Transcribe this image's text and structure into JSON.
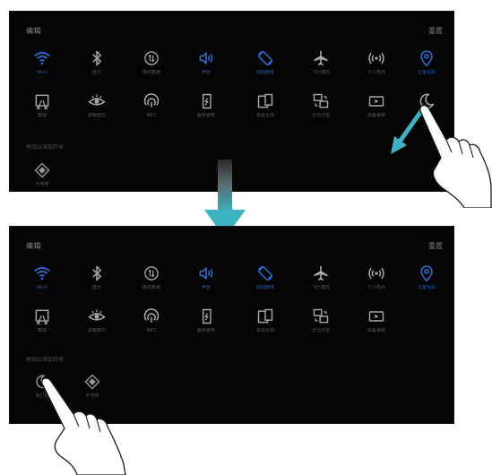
{
  "colors": {
    "panel_bg": "#050505",
    "active_blue": "#2f6fdc",
    "inactive_gray": "#8a8a8a",
    "arrow_teal": "#3bb3c3",
    "arrow_dark": "#2a2a2a"
  },
  "top_panel": {
    "title": "编辑",
    "action": "重置",
    "tiles_row1": [
      {
        "label": "Wi-Fi",
        "icon": "wifi-icon",
        "active": true
      },
      {
        "label": "蓝牙",
        "icon": "bluetooth-icon",
        "active": false
      },
      {
        "label": "移动数据",
        "icon": "mobile-data-icon",
        "active": false
      },
      {
        "label": "声音",
        "icon": "sound-icon",
        "active": true
      },
      {
        "label": "自动旋转",
        "icon": "rotate-icon",
        "active": true
      },
      {
        "label": "飞行模式",
        "icon": "airplane-icon",
        "active": false
      },
      {
        "label": "个人热点",
        "icon": "hotspot-icon",
        "active": false
      },
      {
        "label": "位置信息",
        "icon": "location-icon",
        "active": true
      }
    ],
    "tiles_row2": [
      {
        "label": "截屏",
        "icon": "screenshot-icon",
        "active": false
      },
      {
        "label": "护眼模式",
        "icon": "eye-comfort-icon",
        "active": false
      },
      {
        "label": "NFC",
        "icon": "nfc-icon",
        "active": false
      },
      {
        "label": "超级省电",
        "icon": "power-saving-icon",
        "active": false
      },
      {
        "label": "多屏互动",
        "icon": "multi-screen-icon",
        "active": false
      },
      {
        "label": "华为分享",
        "icon": "share-icon",
        "active": false
      },
      {
        "label": "屏幕录制",
        "icon": "screen-record-icon",
        "active": false
      },
      {
        "label": "免打扰",
        "icon": "moon-icon",
        "active": false
      }
    ],
    "section_label": "拖动以添加开关",
    "extra_tiles": [
      {
        "label": "手电筒",
        "icon": "diamond-icon"
      }
    ]
  },
  "bottom_panel": {
    "title": "编辑",
    "action": "重置",
    "tiles_row1": [
      {
        "label": "Wi-Fi",
        "icon": "wifi-icon",
        "active": true
      },
      {
        "label": "蓝牙",
        "icon": "bluetooth-icon",
        "active": false
      },
      {
        "label": "移动数据",
        "icon": "mobile-data-icon",
        "active": false
      },
      {
        "label": "声音",
        "icon": "sound-icon",
        "active": true
      },
      {
        "label": "自动旋转",
        "icon": "rotate-icon",
        "active": true
      },
      {
        "label": "飞行模式",
        "icon": "airplane-icon",
        "active": false
      },
      {
        "label": "个人热点",
        "icon": "hotspot-icon",
        "active": false
      },
      {
        "label": "位置信息",
        "icon": "location-icon",
        "active": true
      }
    ],
    "tiles_row2": [
      {
        "label": "截屏",
        "icon": "screenshot-icon",
        "active": false
      },
      {
        "label": "护眼模式",
        "icon": "eye-comfort-icon",
        "active": false
      },
      {
        "label": "NFC",
        "icon": "nfc-icon",
        "active": false
      },
      {
        "label": "超级省电",
        "icon": "power-saving-icon",
        "active": false
      },
      {
        "label": "多屏互动",
        "icon": "multi-screen-icon",
        "active": false
      },
      {
        "label": "华为分享",
        "icon": "share-icon",
        "active": false
      },
      {
        "label": "屏幕录制",
        "icon": "screen-record-icon",
        "active": false
      }
    ],
    "section_label": "拖动以添加开关",
    "extra_tiles": [
      {
        "label": "免打扰",
        "icon": "moon-icon"
      },
      {
        "label": "手电筒",
        "icon": "diamond-icon"
      }
    ]
  }
}
